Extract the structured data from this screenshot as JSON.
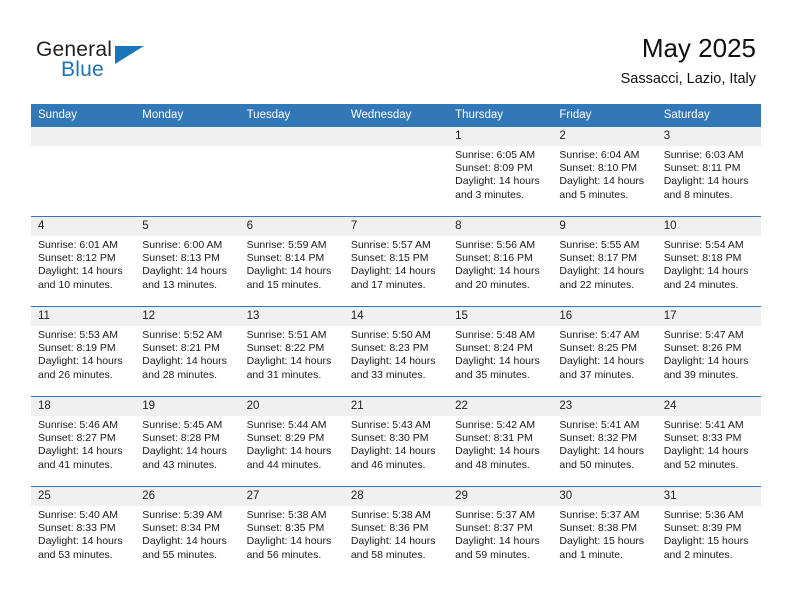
{
  "brand": {
    "name_part1": "General",
    "name_part2": "Blue"
  },
  "header": {
    "month_title": "May 2025",
    "location": "Sassacci, Lazio, Italy"
  },
  "colors": {
    "header_blue": "#3277b8",
    "brand_blue": "#1b75bb",
    "day_band_gray": "#f0f0f0",
    "cell_white": "#ffffff"
  },
  "weekday_headers": [
    "Sunday",
    "Monday",
    "Tuesday",
    "Wednesday",
    "Thursday",
    "Friday",
    "Saturday"
  ],
  "weeks": [
    [
      {
        "day": "",
        "sunrise": "",
        "sunset": "",
        "daylight_line1": "",
        "daylight_line2": "",
        "empty": true
      },
      {
        "day": "",
        "sunrise": "",
        "sunset": "",
        "daylight_line1": "",
        "daylight_line2": "",
        "empty": true
      },
      {
        "day": "",
        "sunrise": "",
        "sunset": "",
        "daylight_line1": "",
        "daylight_line2": "",
        "empty": true
      },
      {
        "day": "",
        "sunrise": "",
        "sunset": "",
        "daylight_line1": "",
        "daylight_line2": "",
        "empty": true
      },
      {
        "day": "1",
        "sunrise": "Sunrise: 6:05 AM",
        "sunset": "Sunset: 8:09 PM",
        "daylight_line1": "Daylight: 14 hours",
        "daylight_line2": "and 3 minutes.",
        "empty": false
      },
      {
        "day": "2",
        "sunrise": "Sunrise: 6:04 AM",
        "sunset": "Sunset: 8:10 PM",
        "daylight_line1": "Daylight: 14 hours",
        "daylight_line2": "and 5 minutes.",
        "empty": false
      },
      {
        "day": "3",
        "sunrise": "Sunrise: 6:03 AM",
        "sunset": "Sunset: 8:11 PM",
        "daylight_line1": "Daylight: 14 hours",
        "daylight_line2": "and 8 minutes.",
        "empty": false
      }
    ],
    [
      {
        "day": "4",
        "sunrise": "Sunrise: 6:01 AM",
        "sunset": "Sunset: 8:12 PM",
        "daylight_line1": "Daylight: 14 hours",
        "daylight_line2": "and 10 minutes.",
        "empty": false
      },
      {
        "day": "5",
        "sunrise": "Sunrise: 6:00 AM",
        "sunset": "Sunset: 8:13 PM",
        "daylight_line1": "Daylight: 14 hours",
        "daylight_line2": "and 13 minutes.",
        "empty": false
      },
      {
        "day": "6",
        "sunrise": "Sunrise: 5:59 AM",
        "sunset": "Sunset: 8:14 PM",
        "daylight_line1": "Daylight: 14 hours",
        "daylight_line2": "and 15 minutes.",
        "empty": false
      },
      {
        "day": "7",
        "sunrise": "Sunrise: 5:57 AM",
        "sunset": "Sunset: 8:15 PM",
        "daylight_line1": "Daylight: 14 hours",
        "daylight_line2": "and 17 minutes.",
        "empty": false
      },
      {
        "day": "8",
        "sunrise": "Sunrise: 5:56 AM",
        "sunset": "Sunset: 8:16 PM",
        "daylight_line1": "Daylight: 14 hours",
        "daylight_line2": "and 20 minutes.",
        "empty": false
      },
      {
        "day": "9",
        "sunrise": "Sunrise: 5:55 AM",
        "sunset": "Sunset: 8:17 PM",
        "daylight_line1": "Daylight: 14 hours",
        "daylight_line2": "and 22 minutes.",
        "empty": false
      },
      {
        "day": "10",
        "sunrise": "Sunrise: 5:54 AM",
        "sunset": "Sunset: 8:18 PM",
        "daylight_line1": "Daylight: 14 hours",
        "daylight_line2": "and 24 minutes.",
        "empty": false
      }
    ],
    [
      {
        "day": "11",
        "sunrise": "Sunrise: 5:53 AM",
        "sunset": "Sunset: 8:19 PM",
        "daylight_line1": "Daylight: 14 hours",
        "daylight_line2": "and 26 minutes.",
        "empty": false
      },
      {
        "day": "12",
        "sunrise": "Sunrise: 5:52 AM",
        "sunset": "Sunset: 8:21 PM",
        "daylight_line1": "Daylight: 14 hours",
        "daylight_line2": "and 28 minutes.",
        "empty": false
      },
      {
        "day": "13",
        "sunrise": "Sunrise: 5:51 AM",
        "sunset": "Sunset: 8:22 PM",
        "daylight_line1": "Daylight: 14 hours",
        "daylight_line2": "and 31 minutes.",
        "empty": false
      },
      {
        "day": "14",
        "sunrise": "Sunrise: 5:50 AM",
        "sunset": "Sunset: 8:23 PM",
        "daylight_line1": "Daylight: 14 hours",
        "daylight_line2": "and 33 minutes.",
        "empty": false
      },
      {
        "day": "15",
        "sunrise": "Sunrise: 5:48 AM",
        "sunset": "Sunset: 8:24 PM",
        "daylight_line1": "Daylight: 14 hours",
        "daylight_line2": "and 35 minutes.",
        "empty": false
      },
      {
        "day": "16",
        "sunrise": "Sunrise: 5:47 AM",
        "sunset": "Sunset: 8:25 PM",
        "daylight_line1": "Daylight: 14 hours",
        "daylight_line2": "and 37 minutes.",
        "empty": false
      },
      {
        "day": "17",
        "sunrise": "Sunrise: 5:47 AM",
        "sunset": "Sunset: 8:26 PM",
        "daylight_line1": "Daylight: 14 hours",
        "daylight_line2": "and 39 minutes.",
        "empty": false
      }
    ],
    [
      {
        "day": "18",
        "sunrise": "Sunrise: 5:46 AM",
        "sunset": "Sunset: 8:27 PM",
        "daylight_line1": "Daylight: 14 hours",
        "daylight_line2": "and 41 minutes.",
        "empty": false
      },
      {
        "day": "19",
        "sunrise": "Sunrise: 5:45 AM",
        "sunset": "Sunset: 8:28 PM",
        "daylight_line1": "Daylight: 14 hours",
        "daylight_line2": "and 43 minutes.",
        "empty": false
      },
      {
        "day": "20",
        "sunrise": "Sunrise: 5:44 AM",
        "sunset": "Sunset: 8:29 PM",
        "daylight_line1": "Daylight: 14 hours",
        "daylight_line2": "and 44 minutes.",
        "empty": false
      },
      {
        "day": "21",
        "sunrise": "Sunrise: 5:43 AM",
        "sunset": "Sunset: 8:30 PM",
        "daylight_line1": "Daylight: 14 hours",
        "daylight_line2": "and 46 minutes.",
        "empty": false
      },
      {
        "day": "22",
        "sunrise": "Sunrise: 5:42 AM",
        "sunset": "Sunset: 8:31 PM",
        "daylight_line1": "Daylight: 14 hours",
        "daylight_line2": "and 48 minutes.",
        "empty": false
      },
      {
        "day": "23",
        "sunrise": "Sunrise: 5:41 AM",
        "sunset": "Sunset: 8:32 PM",
        "daylight_line1": "Daylight: 14 hours",
        "daylight_line2": "and 50 minutes.",
        "empty": false
      },
      {
        "day": "24",
        "sunrise": "Sunrise: 5:41 AM",
        "sunset": "Sunset: 8:33 PM",
        "daylight_line1": "Daylight: 14 hours",
        "daylight_line2": "and 52 minutes.",
        "empty": false
      }
    ],
    [
      {
        "day": "25",
        "sunrise": "Sunrise: 5:40 AM",
        "sunset": "Sunset: 8:33 PM",
        "daylight_line1": "Daylight: 14 hours",
        "daylight_line2": "and 53 minutes.",
        "empty": false
      },
      {
        "day": "26",
        "sunrise": "Sunrise: 5:39 AM",
        "sunset": "Sunset: 8:34 PM",
        "daylight_line1": "Daylight: 14 hours",
        "daylight_line2": "and 55 minutes.",
        "empty": false
      },
      {
        "day": "27",
        "sunrise": "Sunrise: 5:38 AM",
        "sunset": "Sunset: 8:35 PM",
        "daylight_line1": "Daylight: 14 hours",
        "daylight_line2": "and 56 minutes.",
        "empty": false
      },
      {
        "day": "28",
        "sunrise": "Sunrise: 5:38 AM",
        "sunset": "Sunset: 8:36 PM",
        "daylight_line1": "Daylight: 14 hours",
        "daylight_line2": "and 58 minutes.",
        "empty": false
      },
      {
        "day": "29",
        "sunrise": "Sunrise: 5:37 AM",
        "sunset": "Sunset: 8:37 PM",
        "daylight_line1": "Daylight: 14 hours",
        "daylight_line2": "and 59 minutes.",
        "empty": false
      },
      {
        "day": "30",
        "sunrise": "Sunrise: 5:37 AM",
        "sunset": "Sunset: 8:38 PM",
        "daylight_line1": "Daylight: 15 hours",
        "daylight_line2": "and 1 minute.",
        "empty": false
      },
      {
        "day": "31",
        "sunrise": "Sunrise: 5:36 AM",
        "sunset": "Sunset: 8:39 PM",
        "daylight_line1": "Daylight: 15 hours",
        "daylight_line2": "and 2 minutes.",
        "empty": false
      }
    ]
  ]
}
